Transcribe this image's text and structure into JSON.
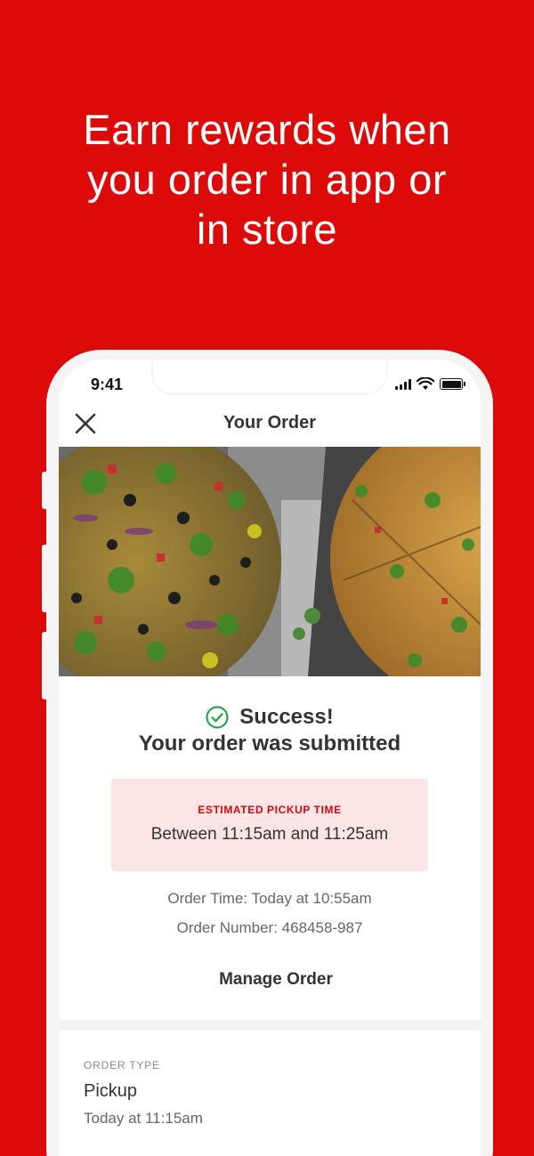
{
  "promo": {
    "headline": "Earn rewards when\nyou order in app or\nin store"
  },
  "status_bar": {
    "time": "9:41"
  },
  "nav": {
    "title": "Your Order"
  },
  "confirmation": {
    "success": "Success!",
    "message": "Your order was submitted"
  },
  "pickup": {
    "label": "ESTIMATED PICKUP TIME",
    "window": "Between 11:15am and 11:25am"
  },
  "order_info": {
    "time": "Order Time: Today at 10:55am",
    "number": "Order Number: 468458-987"
  },
  "actions": {
    "manage_order": "Manage Order"
  },
  "order_type": {
    "label": "ORDER TYPE",
    "value": "Pickup",
    "time": "Today at 11:15am"
  },
  "icons": {
    "close": "close-icon",
    "success": "check-circle-icon",
    "signal": "cellular-signal-icon",
    "wifi": "wifi-icon",
    "battery": "battery-icon"
  },
  "colors": {
    "brand_red": "#dd0a0a",
    "success_green": "#2fa34a",
    "pickup_bg": "#fbe4e4",
    "pickup_label": "#d20a0a"
  }
}
